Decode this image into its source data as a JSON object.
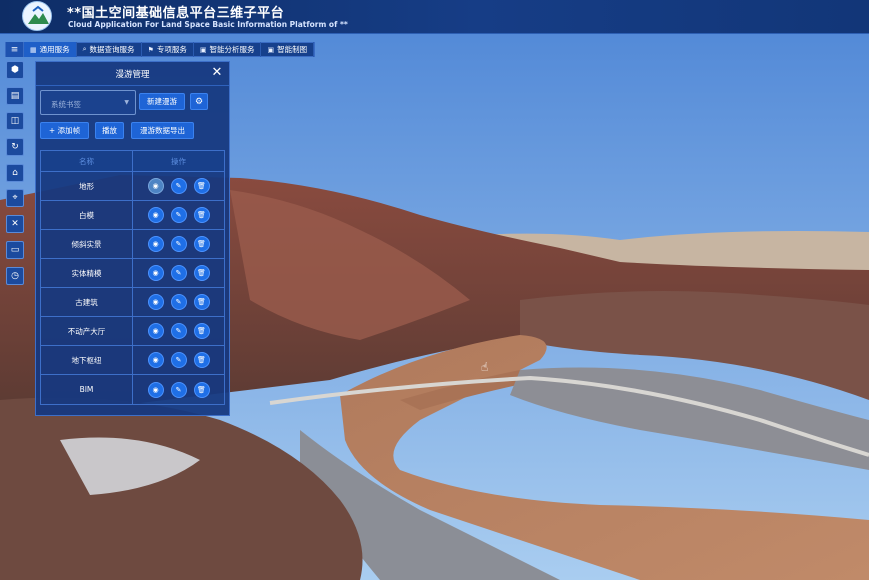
{
  "header": {
    "title": "**国土空间基础信息平台三维子平台",
    "subtitle": "Cloud Application For Land Space Basic Information Platform of **"
  },
  "menubar": {
    "toggle_icon": "hamburger-icon",
    "items": [
      {
        "label": "通用服务",
        "icon": "grid-icon",
        "active": true
      },
      {
        "label": "数据查询服务",
        "icon": "search-icon",
        "active": false
      },
      {
        "label": "专项服务",
        "icon": "flag-icon",
        "active": false
      },
      {
        "label": "智能分析服务",
        "icon": "image-icon",
        "active": false
      },
      {
        "label": "智能制图",
        "icon": "image-icon",
        "active": false
      }
    ]
  },
  "toolbar": {
    "icons": [
      "cube-icon",
      "layers-icon",
      "split-icon",
      "refresh-icon",
      "tag-icon",
      "location-icon",
      "tools-icon",
      "save-icon",
      "clock-icon"
    ]
  },
  "panel": {
    "title": "漫游管理",
    "select_placeholder": "系统书签",
    "new_roam_label": "新建漫游",
    "add_frame_label": "+ 添加帧",
    "play_label": "播放",
    "export_label": "漫游数据导出",
    "table": {
      "headers": [
        "名称",
        "操作"
      ],
      "rows": [
        {
          "name": "地形",
          "visible": true
        },
        {
          "name": "白模",
          "visible": false
        },
        {
          "name": "倾斜实景",
          "visible": false
        },
        {
          "name": "实体精模",
          "visible": false
        },
        {
          "name": "古建筑",
          "visible": false
        },
        {
          "name": "不动产大厅",
          "visible": false
        },
        {
          "name": "地下枢纽",
          "visible": false
        },
        {
          "name": "BIM",
          "visible": false
        }
      ]
    }
  },
  "colors": {
    "header_bg": "#0e2d66",
    "panel_bg": "#163880",
    "button": "#1e64d6",
    "accent_border": "#3d6fc9"
  }
}
